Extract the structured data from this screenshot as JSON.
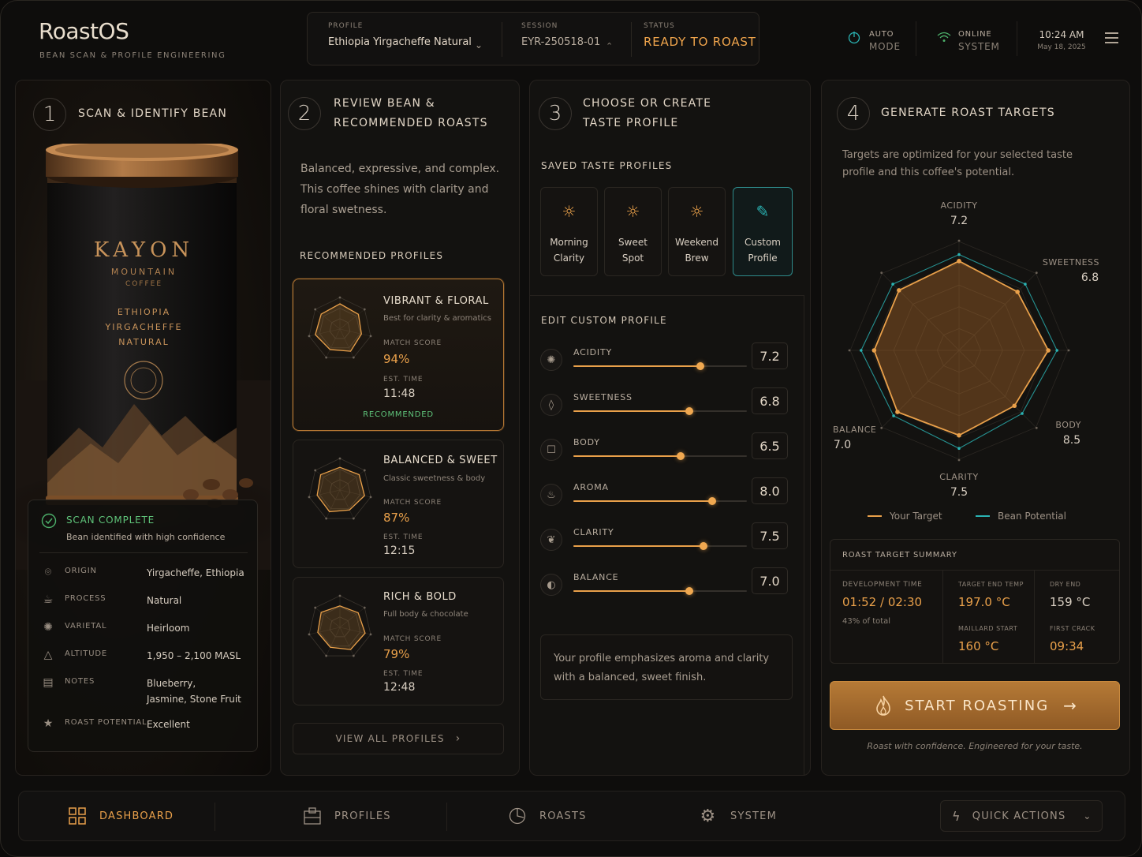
{
  "app": {
    "title": "RoastOS",
    "subtitle": "BEAN SCAN & PROFILE ENGINEERING"
  },
  "header": {
    "profile_label": "PROFILE",
    "profile_value": "Ethiopia Yirgacheffe Natural",
    "session_label": "SESSION",
    "session_value": "EYR-250518-01",
    "status_label": "STATUS",
    "status_value": "READY TO ROAST",
    "auto_label": "AUTO",
    "auto_value": "MODE",
    "online_label": "ONLINE",
    "online_value": "SYSTEM",
    "time": "10:24 AM",
    "date": "May 18, 2025"
  },
  "step1": {
    "num": "1",
    "title": "SCAN & IDENTIFY BEAN",
    "can": {
      "brand": "KAYON",
      "line1": "MOUNTAIN",
      "line2": "COFFEE",
      "origin1": "ETHIOPIA",
      "origin2": "YIRGACHEFFE",
      "origin3": "NATURAL"
    },
    "scan_status": "SCAN COMPLETE",
    "scan_sub": "Bean identified with high confidence",
    "rows": [
      {
        "k": "ORIGIN",
        "v": "Yirgacheffe, Ethiopia",
        "icon": "location-icon"
      },
      {
        "k": "PROCESS",
        "v": "Natural",
        "icon": "process-icon"
      },
      {
        "k": "VARIETAL",
        "v": "Heirloom",
        "icon": "varietal-icon"
      },
      {
        "k": "ALTITUDE",
        "v": "1,950 – 2,100 MASL",
        "icon": "mountain-icon"
      },
      {
        "k": "NOTES",
        "v": "Blueberry,",
        "v2": "Jasmine, Stone Fruit",
        "icon": "notes-icon"
      },
      {
        "k": "ROAST POTENTIAL",
        "v": "Excellent",
        "icon": "star-icon"
      }
    ]
  },
  "step2": {
    "num": "2",
    "title1": "REVIEW BEAN &",
    "title2": "RECOMMENDED ROASTS",
    "desc1": "Balanced, expressive, and complex.",
    "desc2": "This coffee shines with clarity and",
    "desc3": "floral swetness.",
    "section": "RECOMMENDED PROFILES",
    "profiles": [
      {
        "title": "VIBRANT & FLORAL",
        "sub": "Best for clarity & aromatics",
        "match_label": "MATCH SCORE",
        "match": "94%",
        "time_label": "EST. TIME",
        "time": "11:48",
        "badge": "RECOMMENDED"
      },
      {
        "title": "BALANCED & SWEET",
        "sub": "Classic sweetness & body",
        "match_label": "MATCH SCORE",
        "match": "87%",
        "time_label": "EST. TIME",
        "time": "12:15"
      },
      {
        "title": "RICH & BOLD",
        "sub": "Full body & chocolate",
        "match_label": "MATCH SCORE",
        "match": "79%",
        "time_label": "EST. TIME",
        "time": "12:48"
      }
    ],
    "view_all": "VIEW ALL PROFILES"
  },
  "step3": {
    "num": "3",
    "title1": "CHOOSE OR CREATE",
    "title2": "TASTE PROFILE",
    "saved_label": "SAVED TASTE PROFILES",
    "tiles": [
      {
        "l1": "Morning",
        "l2": "Clarity"
      },
      {
        "l1": "Sweet Spot",
        "l2": ""
      },
      {
        "l1": "Weekend",
        "l2": "Brew"
      },
      {
        "l1": "Custom",
        "l2": "Profile"
      }
    ],
    "edit_label": "EDIT CUSTOM PROFILE",
    "sliders": [
      {
        "name": "ACIDITY",
        "value": "7.2",
        "pct": 0.73
      },
      {
        "name": "SWEETNESS",
        "value": "6.8",
        "pct": 0.67
      },
      {
        "name": "BODY",
        "value": "6.5",
        "pct": 0.62
      },
      {
        "name": "AROMA",
        "value": "8.0",
        "pct": 0.8
      },
      {
        "name": "CLARITY",
        "value": "7.5",
        "pct": 0.75
      },
      {
        "name": "BALANCE",
        "value": "7.0",
        "pct": 0.67
      }
    ],
    "note1": "Your profile emphasizes aroma and clarity",
    "note2": "with a balanced, sweet finish."
  },
  "step4": {
    "num": "4",
    "title": "GENERATE ROAST TARGETS",
    "desc1": "Targets are optimized for your selected taste",
    "desc2": "profile and this coffee's potential.",
    "radar": {
      "axes": [
        {
          "name": "ACIDITY",
          "value": "7.2"
        },
        {
          "name": "SWEETNESS",
          "value": "6.8"
        },
        {
          "name": "BODY",
          "value": "8.5"
        },
        {
          "name": "CLARITY",
          "value": "7.5"
        },
        {
          "name": "BALANCE",
          "value": "7.0"
        }
      ],
      "legend_target": "Your Target",
      "legend_potential": "Bean Potential",
      "target_color": "#e9a04a",
      "potential_color": "#2ab3b3"
    },
    "summary": {
      "title": "ROAST TARGET SUMMARY",
      "dev_label": "DEVELOPMENT TIME",
      "dev_value": "01:52 / 02:30",
      "dev_sub": "43% of total",
      "end_label": "TARGET END TEMP",
      "end_value": "197.0 °C",
      "dry_label": "DRY END",
      "dry_value": "159 °C",
      "maillard_label": "MAILLARD START",
      "maillard_value": "160 °C",
      "crack_label": "FIRST CRACK",
      "crack_value": "09:34"
    },
    "start_label": "START ROASTING",
    "tagline": "Roast with confidence. Engineered for your taste."
  },
  "nav": {
    "dashboard": "DASHBOARD",
    "profiles": "PROFILES",
    "roasts": "ROASTS",
    "system": "SYSTEM",
    "quick": "QUICK ACTIONS"
  },
  "colors": {
    "accent": "#e9a04a",
    "teal": "#2ab3b3",
    "ok": "#4caf6a"
  }
}
